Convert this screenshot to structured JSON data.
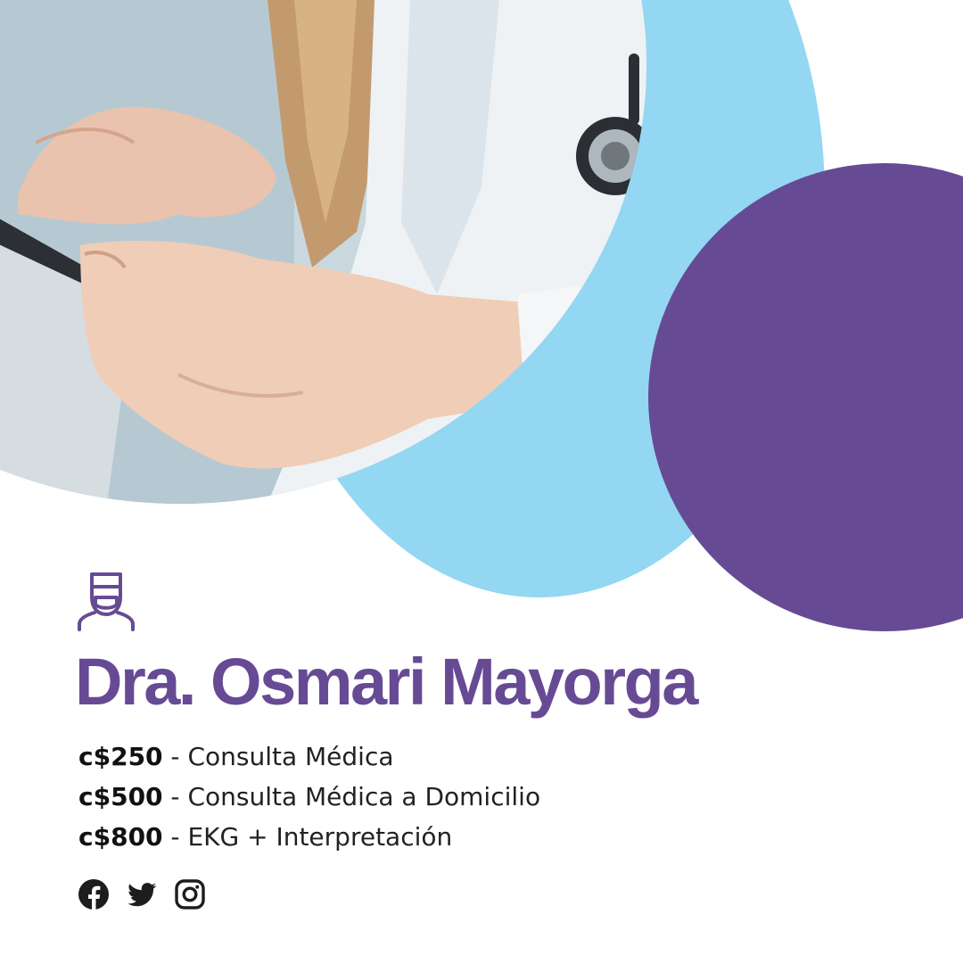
{
  "doctor": {
    "name": "Dra. Osmari Mayorga",
    "icon": "doctor-mask-icon"
  },
  "services": [
    {
      "price": "c$250",
      "separator": " - ",
      "description": "Consulta Médica"
    },
    {
      "price": "c$500",
      "separator": " - ",
      "description": "Consulta Médica a Domicilio"
    },
    {
      "price": "c$800",
      "separator": " - ",
      "description": "EKG + Interpretación"
    }
  ],
  "social": [
    {
      "icon": "facebook-icon"
    },
    {
      "icon": "twitter-icon"
    },
    {
      "icon": "instagram-icon"
    }
  ],
  "colors": {
    "brand_purple": "#674a94",
    "accent_blue": "#93d7f2",
    "text": "#222222"
  }
}
